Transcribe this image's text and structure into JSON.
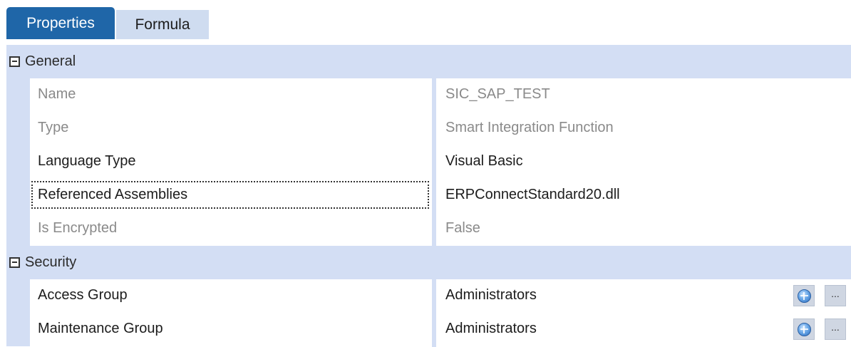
{
  "tabs": [
    {
      "label": "Properties",
      "active": true
    },
    {
      "label": "Formula",
      "active": false
    }
  ],
  "categories": {
    "general": {
      "title": "General"
    },
    "security": {
      "title": "Security"
    }
  },
  "properties": {
    "name": {
      "label": "Name",
      "value": "SIC_SAP_TEST"
    },
    "type": {
      "label": "Type",
      "value": "Smart Integration Function"
    },
    "language_type": {
      "label": "Language Type",
      "value": "Visual Basic"
    },
    "referenced_assemblies": {
      "label": "Referenced Assemblies",
      "value": "ERPConnectStandard20.dll"
    },
    "is_encrypted": {
      "label": "Is Encrypted",
      "value": "False"
    },
    "access_group": {
      "label": "Access Group",
      "value": "Administrators"
    },
    "maintenance_group": {
      "label": "Maintenance Group",
      "value": "Administrators"
    }
  },
  "buttons": {
    "ellipsis": "..."
  },
  "colors": {
    "accent": "#1f66a8",
    "category_bg": "#d3def4",
    "muted_text": "#8a8a8a"
  },
  "icons": {
    "collapse": "collapse-toggle-icon",
    "group_picker": "globe-icon"
  }
}
